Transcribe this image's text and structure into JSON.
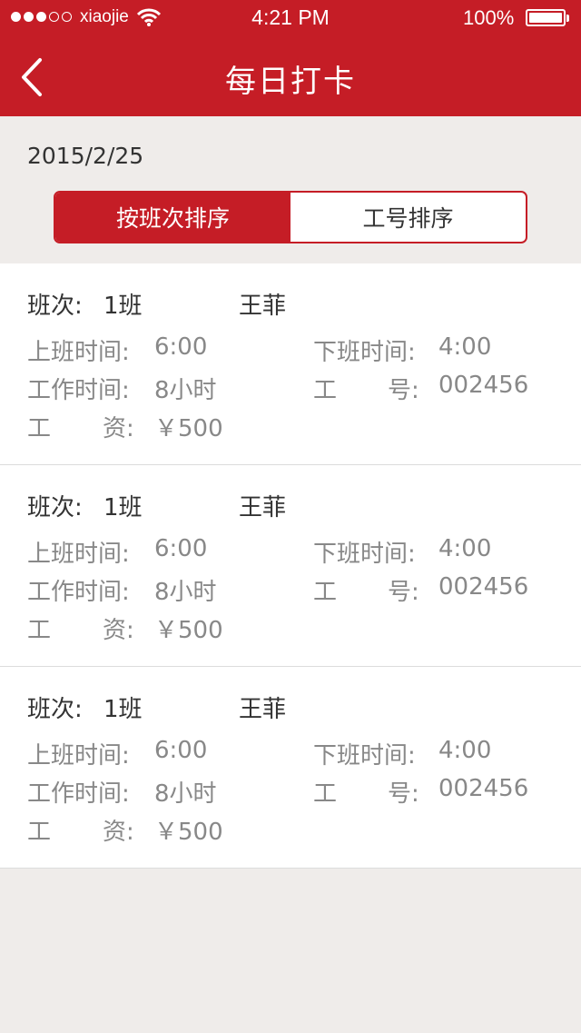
{
  "status_bar": {
    "carrier": "xiaojie",
    "time": "4:21 PM",
    "battery": "100%"
  },
  "nav": {
    "title": "每日打卡",
    "back_icon": "chevron-left-icon"
  },
  "date": "2015/2/25",
  "sort_tabs": [
    {
      "label": "按班次排序",
      "active": true
    },
    {
      "label": "工号排序",
      "active": false
    }
  ],
  "records": [
    {
      "shift_label": "班次:",
      "shift": "1班",
      "name": "王菲",
      "start_label": "上班时间:",
      "start": "6:00",
      "end_label": "下班时间:",
      "end": "4:00",
      "hours_label": "工作时间:",
      "hours": "8小时",
      "id_label_a": "工",
      "id_label_b": "号:",
      "id": "002456",
      "pay_label_a": "工",
      "pay_label_b": "资:",
      "pay": "￥500"
    },
    {
      "shift_label": "班次:",
      "shift": "1班",
      "name": "王菲",
      "start_label": "上班时间:",
      "start": "6:00",
      "end_label": "下班时间:",
      "end": "4:00",
      "hours_label": "工作时间:",
      "hours": "8小时",
      "id_label_a": "工",
      "id_label_b": "号:",
      "id": "002456",
      "pay_label_a": "工",
      "pay_label_b": "资:",
      "pay": "￥500"
    },
    {
      "shift_label": "班次:",
      "shift": "1班",
      "name": "王菲",
      "start_label": "上班时间:",
      "start": "6:00",
      "end_label": "下班时间:",
      "end": "4:00",
      "hours_label": "工作时间:",
      "hours": "8小时",
      "id_label_a": "工",
      "id_label_b": "号:",
      "id": "002456",
      "pay_label_a": "工",
      "pay_label_b": "资:",
      "pay": "￥500"
    }
  ]
}
